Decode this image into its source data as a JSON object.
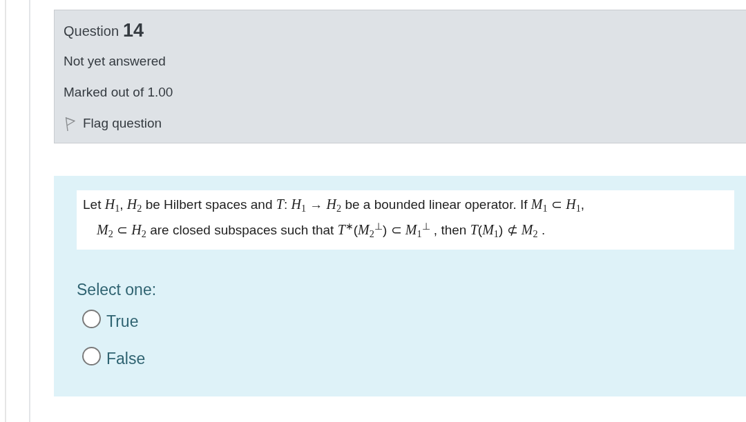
{
  "question": {
    "label": "Question",
    "number": "14",
    "state": "Not yet answered",
    "grade": "Marked out of 1.00",
    "flag": {
      "label": "Flag question",
      "flagged": false
    }
  },
  "question_text": "Let *H*$_{1}$, *H*$_{2}$ be Hilbert spaces and *T*: *H*$_{1}$ → *H*$_{2}$ be a bounded linear operator. If *M*$_{1}$ ⊂ *H*$_{1}$,\n*M*$_{2}$ ⊂ *H*$_{2}$ are closed subspaces such that *T*$^{∗}$(*M*$_{2}$$^{⊥}$) ⊂ *M*$_{1}$$^{⊥}$ , then *T*(*M*$_{1}$) ⊄ *M*$_{2}$ .",
  "prompt": "Select one:",
  "options": [
    {
      "label": "True",
      "selected": false
    },
    {
      "label": "False",
      "selected": false
    }
  ]
}
